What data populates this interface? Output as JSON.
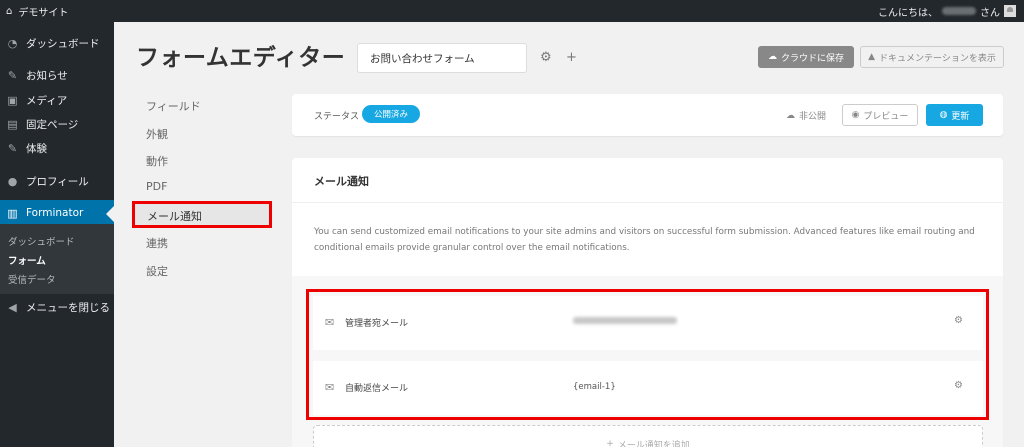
{
  "adminbar": {
    "site_name": "デモサイト",
    "greeting": "こんにちは、",
    "suffix": "さん"
  },
  "sidebar": {
    "items": [
      {
        "label": "ダッシュボード",
        "icon": "dashboard-icon"
      },
      {
        "label": "お知らせ",
        "icon": "pin-icon"
      },
      {
        "label": "メディア",
        "icon": "media-icon"
      },
      {
        "label": "固定ページ",
        "icon": "page-icon"
      },
      {
        "label": "体験",
        "icon": "pin-icon"
      },
      {
        "label": "プロフィール",
        "icon": "user-icon"
      },
      {
        "label": "Forminator",
        "icon": "clipboard-icon"
      }
    ],
    "submenu": [
      "ダッシュボード",
      "フォーム",
      "受信データ"
    ],
    "collapse": "メニューを閉じる"
  },
  "header": {
    "title": "フォームエディター",
    "form_name": "お問い合わせフォーム",
    "save_cloud": "クラウドに保存",
    "docs": "ドキュメンテーションを表示"
  },
  "nav": [
    "フィールド",
    "外観",
    "動作",
    "PDF",
    "メール通知",
    "連携",
    "設定"
  ],
  "status": {
    "label": "ステータス",
    "state": "公開済み",
    "unpublish": "非公開",
    "preview": "プレビュー",
    "update": "更新"
  },
  "mail": {
    "title": "メール通知",
    "description": "You can send customized email notifications to your site admins and visitors on successful form submission. Advanced features like email routing and conditional emails provide granular control over the email notifications.",
    "rows": [
      {
        "name": "管理者宛メール",
        "value": ""
      },
      {
        "name": "自動返信メール",
        "value": "{email-1}"
      }
    ],
    "add": "メール通知を追加"
  },
  "colors": {
    "accent": "#17a8e3",
    "wp_blue": "#0073aa",
    "highlight": "#ee0000"
  }
}
